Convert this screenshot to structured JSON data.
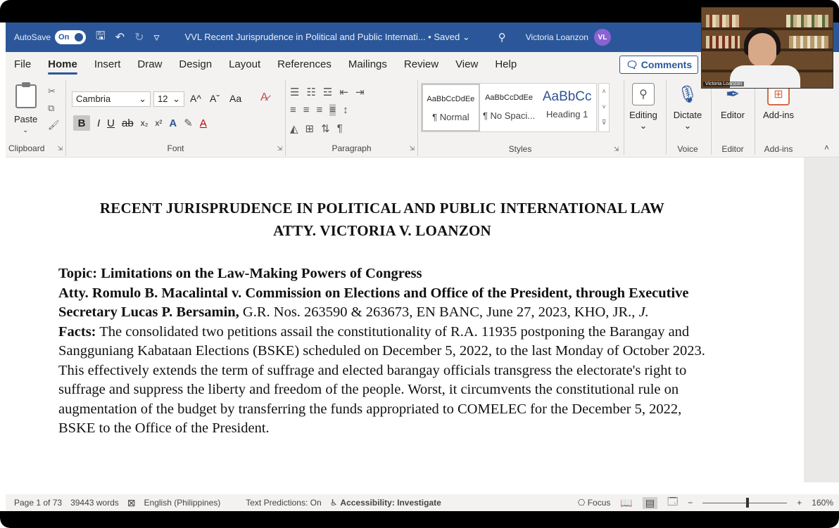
{
  "titlebar": {
    "autosave_label": "AutoSave",
    "autosave_state": "On",
    "title": "VVL Recent Jurisprudence in Political and Public Internati... • Saved",
    "title_chevron": "⌄",
    "user_name": "Victoria Loanzon",
    "user_initials": "VL"
  },
  "menu": {
    "items": [
      "File",
      "Home",
      "Insert",
      "Draw",
      "Design",
      "Layout",
      "References",
      "Mailings",
      "Review",
      "View",
      "Help"
    ],
    "active": "Home",
    "comments_label": "Comments"
  },
  "ribbon": {
    "clipboard": {
      "paste_label": "Paste",
      "group_label": "Clipboard"
    },
    "font": {
      "font_name": "Cambria",
      "font_size": "12",
      "grow": "A^",
      "shrink": "Aˇ",
      "case": "Aa",
      "group_label": "Font"
    },
    "paragraph": {
      "group_label": "Paragraph"
    },
    "styles": {
      "items": [
        {
          "sample": "AaBbCcDdEe",
          "name": "¶ Normal"
        },
        {
          "sample": "AaBbCcDdEe",
          "name": "¶ No Spaci..."
        },
        {
          "sample": "AaBbCc",
          "name": "Heading 1"
        }
      ],
      "group_label": "Styles"
    },
    "editing": {
      "label": "Editing"
    },
    "voice": {
      "dictate_label": "Dictate",
      "group_label": "Voice"
    },
    "editor": {
      "label": "Editor",
      "group_label": "Editor"
    },
    "addins": {
      "label": "Add-ins",
      "group_label": "Add-ins"
    }
  },
  "webcam": {
    "name": "Victoria Loanzon"
  },
  "document": {
    "heading_line1": "RECENT JURISPRUDENCE IN POLITICAL AND PUBLIC INTERNATIONAL LAW",
    "heading_line2": "ATTY. VICTORIA V. LOANZON",
    "topic": "Topic: Limitations on the Law-Making Powers of Congress",
    "case_title": "Atty. Romulo B. Macalintal v. Commission on Elections and Office of the President, through Executive Secretary Lucas P. Bersamin,",
    "case_citation": " G.R. Nos. 263590 & 263673, EN BANC, June 27, 2023, KHO, JR., ",
    "case_ponente": "J.",
    "facts_label": "Facts:",
    "facts_text": " The consolidated two petitions assail the constitutionality of R.A. 11935 postponing the Barangay and Sangguniang Kabataan Elections (BSKE) scheduled on December 5, 2022, to the last Monday of October 2023. This effectively extends the term of suffrage and elected barangay officials transgress the electorate's right to suffrage and suppress the liberty and freedom of the people. Worst, it circumvents the constitutional rule on augmentation of the budget by transferring the funds appropriated to COMELEC for the December 5, 2022, BSKE to the Office of the President."
  },
  "statusbar": {
    "page": "Page 1 of 73",
    "words": "39443 words",
    "language": "English (Philippines)",
    "predictions": "Text Predictions: On",
    "accessibility": "Accessibility: Investigate",
    "focus": "Focus",
    "zoom_minus": "−",
    "zoom_plus": "+",
    "zoom": "160%"
  }
}
